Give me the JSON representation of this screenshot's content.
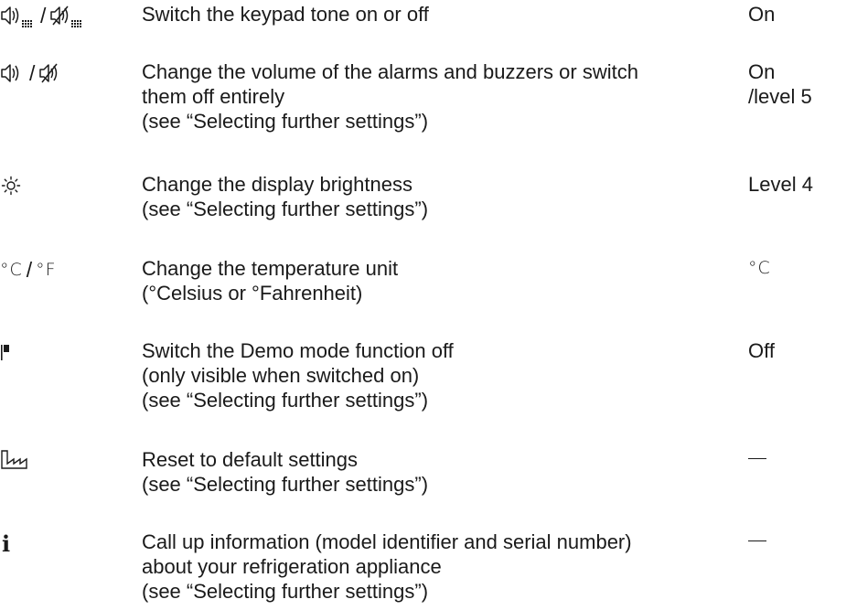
{
  "settings": [
    {
      "icon": "keypad-tone-icon",
      "description": [
        "Switch the keypad tone on or off"
      ],
      "default": [
        "On"
      ]
    },
    {
      "icon": "volume-icon",
      "description": [
        "Change the volume of the alarms and buzzers or switch",
        "them off entirely",
        "(see “Selecting further settings”)"
      ],
      "default": [
        "On",
        "/level 5"
      ]
    },
    {
      "icon": "brightness-icon",
      "description": [
        "Change the display brightness",
        "(see “Selecting further settings”)"
      ],
      "default": [
        "Level 4"
      ]
    },
    {
      "icon": "temperature-unit-icon",
      "symbol_text": [
        "°C",
        "/",
        "°F"
      ],
      "description": [
        "Change the temperature unit",
        "(°Celsius or °Fahrenheit)"
      ],
      "default": [
        "°C"
      ]
    },
    {
      "icon": "demo-mode-icon",
      "description": [
        "Switch the Demo mode function off",
        "(only visible when switched on)",
        "(see “Selecting further settings”)"
      ],
      "default": [
        "Off"
      ]
    },
    {
      "icon": "factory-reset-icon",
      "description": [
        "Reset to default settings",
        "(see “Selecting further settings”)"
      ],
      "default": []
    },
    {
      "icon": "info-icon",
      "symbol_text": [
        "i"
      ],
      "description": [
        "Call up information (model identifier and serial number)",
        "about your refrigeration appliance",
        "(see “Selecting further settings”)"
      ],
      "default": []
    }
  ]
}
